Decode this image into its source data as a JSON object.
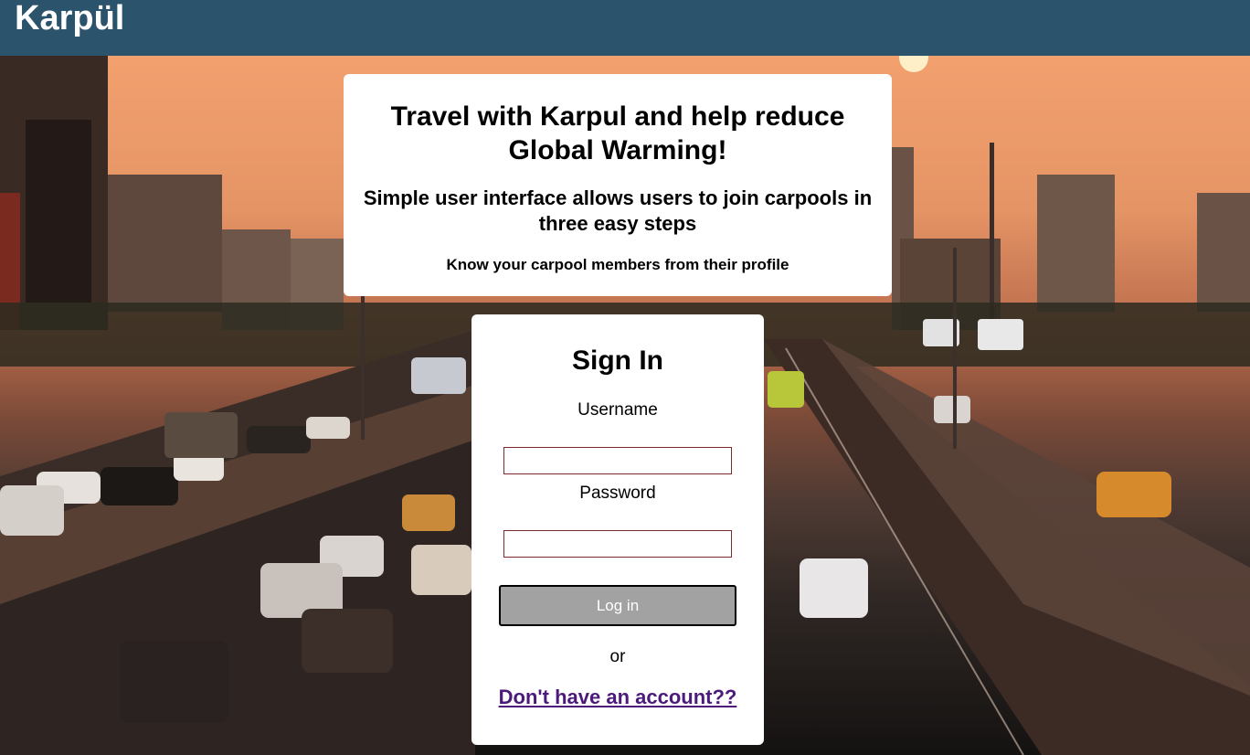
{
  "header": {
    "brand": "Karpül"
  },
  "info": {
    "title": "Travel with Karpul and help reduce Global Warming!",
    "subtitle": "Simple user interface allows users to join carpools in three easy steps",
    "note": "Know your carpool members from their profile"
  },
  "signin": {
    "title": "Sign In",
    "username_label": "Username",
    "username_value": "",
    "password_label": "Password",
    "password_value": "",
    "login_label": "Log in",
    "or_text": "or",
    "signup_link": "Don't have an account??"
  },
  "colors": {
    "header_bg": "#2b546c",
    "link": "#4b1a7a",
    "button_bg": "#a2a2a2"
  }
}
